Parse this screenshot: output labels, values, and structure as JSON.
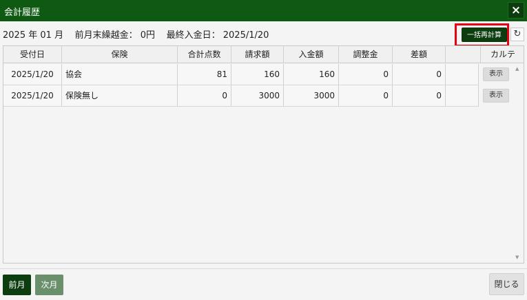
{
  "window": {
    "title": "会計履歴",
    "close_icon": "×"
  },
  "info": {
    "year": "2025",
    "year_unit": "年",
    "month": "01",
    "month_unit": "月",
    "carryover_label": "前月末繰越金：",
    "carryover_value": "0円",
    "last_payment_label": "最終入金日：",
    "last_payment_value": "2025/1/20"
  },
  "toolbar": {
    "recalc_label": "一括再計算",
    "refresh_icon": "↻"
  },
  "table": {
    "columns": [
      "受付日",
      "保険",
      "合計点数",
      "請求額",
      "入金額",
      "調整金",
      "差額",
      "",
      "カルテ"
    ],
    "rows": [
      {
        "date": "2025/1/20",
        "insurance": "協会",
        "points": "81",
        "billed": "160",
        "paid": "160",
        "adjust": "0",
        "diff": "0",
        "extra": "",
        "chart_btn": "表示"
      },
      {
        "date": "2025/1/20",
        "insurance": "保険無し",
        "points": "0",
        "billed": "3000",
        "paid": "3000",
        "adjust": "0",
        "diff": "0",
        "extra": "",
        "chart_btn": "表示"
      }
    ]
  },
  "footer": {
    "prev_label": "前月",
    "next_label": "次月",
    "close_label": "閉じる"
  },
  "colors": {
    "titlebar": "#0e5a12",
    "primary_button": "#0b3d0e",
    "disabled_button": "#6a8f6b",
    "highlight": "#e60012"
  }
}
